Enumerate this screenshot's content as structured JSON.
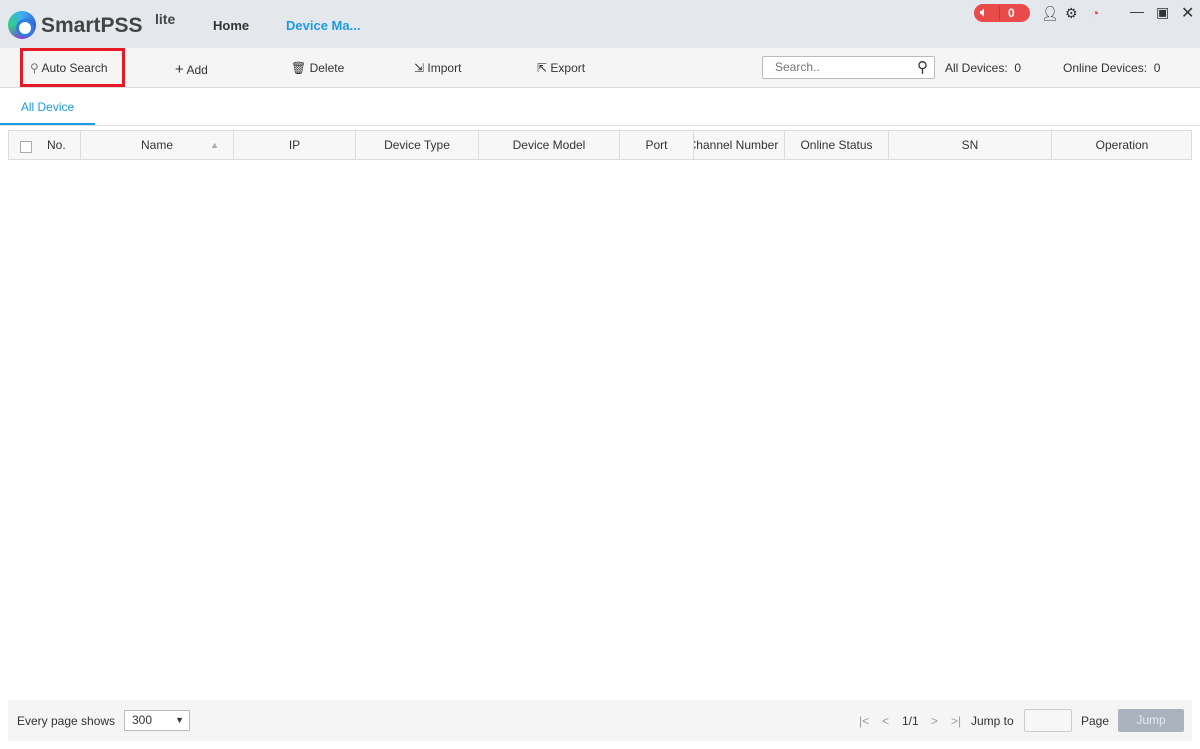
{
  "app": {
    "name": "SmartPSS",
    "suffix": "lite"
  },
  "nav": {
    "home": "Home",
    "device_manager": "Device Ma..."
  },
  "header": {
    "alarm_count": "0",
    "accent": "#1a9be8"
  },
  "toolbar": {
    "auto_search": "Auto Search",
    "add": "Add",
    "delete": "Delete",
    "import": "Import",
    "export": "Export",
    "search_placeholder": "Search..",
    "all_devices_label": "All Devices:",
    "all_devices": "0",
    "online_devices_label": "Online Devices:",
    "online_devices": "0"
  },
  "tabs": [
    {
      "label": "All Device"
    }
  ],
  "table": {
    "columns": [
      "No.",
      "Name",
      "IP",
      "Device Type",
      "Device Model",
      "Port",
      "Channel Number",
      "Online Status",
      "SN",
      "Operation"
    ],
    "rows": []
  },
  "footer": {
    "page_size_label": "Every page shows",
    "page_size": "300",
    "page": "1/1",
    "jump_to": "Jump to",
    "page_label": "Page",
    "jump": "Jump"
  }
}
